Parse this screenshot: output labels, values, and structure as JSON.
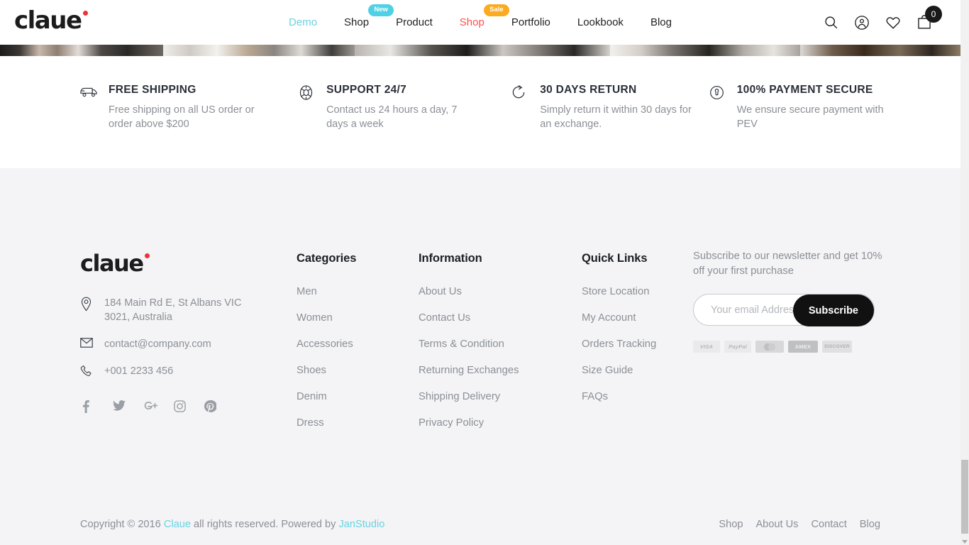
{
  "brand": {
    "name": "claue",
    "accent_dot": "#ed3237"
  },
  "header": {
    "nav": [
      {
        "label": "Demo",
        "badge": null,
        "style": "demo"
      },
      {
        "label": "Shop",
        "badge": "New",
        "style": "normal"
      },
      {
        "label": "Product",
        "badge": null,
        "style": "normal"
      },
      {
        "label": "Shop",
        "badge": "Sale",
        "style": "sale"
      },
      {
        "label": "Portfolio",
        "badge": null,
        "style": "normal"
      },
      {
        "label": "Lookbook",
        "badge": null,
        "style": "normal"
      },
      {
        "label": "Blog",
        "badge": null,
        "style": "normal"
      }
    ],
    "icons": [
      {
        "name": "search-icon"
      },
      {
        "name": "account-icon"
      },
      {
        "name": "wishlist-icon"
      },
      {
        "name": "cart-icon"
      }
    ],
    "cart_count": "0",
    "badge_colors": {
      "new": "#4fd1e3",
      "sale": "#fbab20"
    },
    "demo_color": "#68d3e0",
    "sale_color": "#ff4d4d"
  },
  "features": [
    {
      "icon": "shipping-truck-icon",
      "title": "FREE SHIPPING",
      "desc": "Free shipping on all US order or order above $200"
    },
    {
      "icon": "support-lifebuoy-icon",
      "title": "SUPPORT 24/7",
      "desc": "Contact us 24 hours a day, 7 days a week"
    },
    {
      "icon": "return-arrow-icon",
      "title": "30 DAYS RETURN",
      "desc": "Simply return it within 30 days for an exchange."
    },
    {
      "icon": "payment-lock-icon",
      "title": "100% PAYMENT SECURE",
      "desc": "We ensure secure payment with PEV"
    }
  ],
  "footer": {
    "contact": {
      "address": "184 Main Rd E, St Albans VIC 3021, Australia",
      "email": "contact@company.com",
      "phone": "+001 2233 456"
    },
    "socials": [
      {
        "name": "facebook-icon"
      },
      {
        "name": "twitter-icon"
      },
      {
        "name": "google-plus-icon"
      },
      {
        "name": "instagram-icon"
      },
      {
        "name": "pinterest-icon"
      }
    ],
    "columns": [
      {
        "title": "Categories",
        "links": [
          "Men",
          "Women",
          "Accessories",
          "Shoes",
          "Denim",
          "Dress"
        ]
      },
      {
        "title": "Information",
        "links": [
          "About Us",
          "Contact Us",
          "Terms & Condition",
          "Returning Exchanges",
          "Shipping Delivery",
          "Privacy Policy"
        ]
      },
      {
        "title": "Quick Links",
        "links": [
          "Store Location",
          "My Account",
          "Orders Tracking",
          "Size Guide",
          "FAQs"
        ]
      }
    ],
    "newsletter": {
      "text": "Subscribe to our newsletter and get 10% off your first purchase",
      "placeholder": "Your email Address",
      "button": "Subscribe"
    },
    "payments": [
      "VISA",
      "PayPal",
      "MasterCard",
      "AMEX",
      "DISCOVER"
    ],
    "bottom": {
      "copy_prefix": "Copyright © 2016 ",
      "copy_brand": "Claue",
      "copy_mid": " all rights reserved. Powered by ",
      "copy_author": "JanStudio",
      "links": [
        "Shop",
        "About Us",
        "Contact",
        "Blog"
      ]
    }
  }
}
